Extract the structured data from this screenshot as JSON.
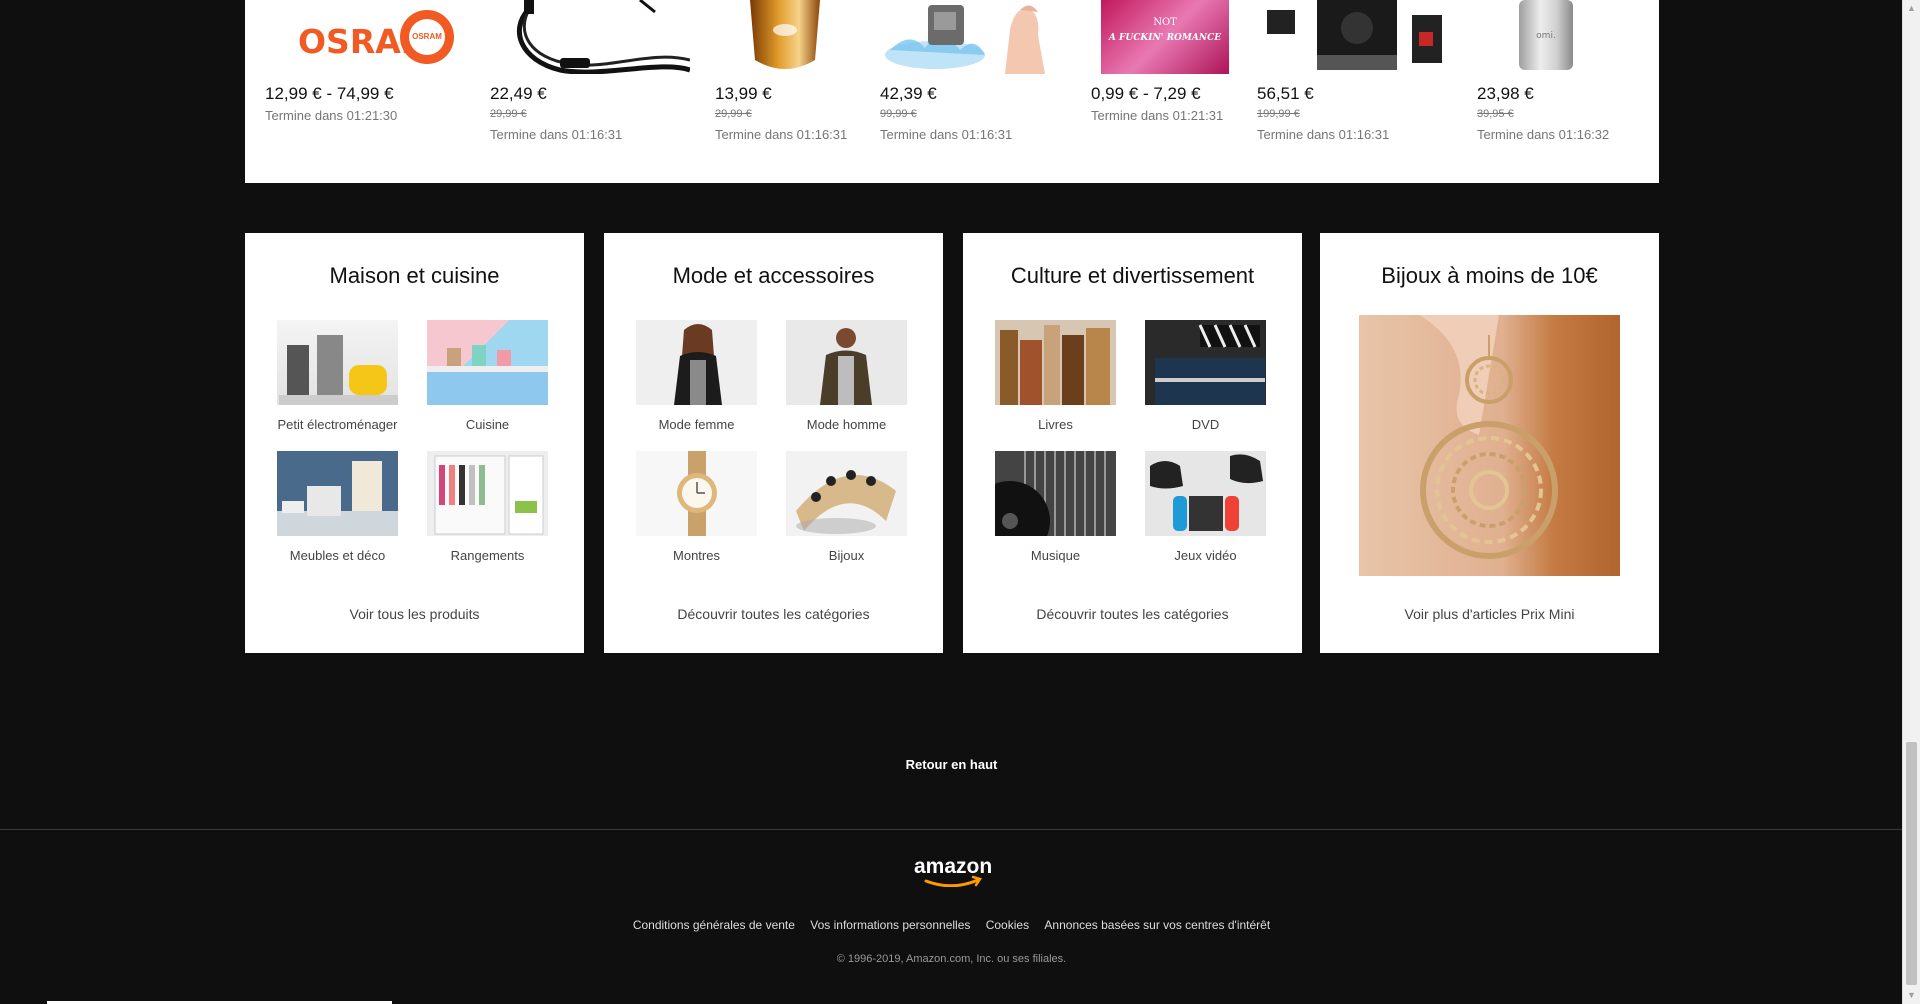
{
  "deals": [
    {
      "price": "12,99 € - 74,99 €",
      "old": "",
      "ends": "Termine dans 01:21:30",
      "brand": "OSRAM",
      "brand_badge": "OSRAM"
    },
    {
      "price": "22,49 €",
      "old": "29,99 €",
      "ends": "Termine dans 01:16:31"
    },
    {
      "price": "13,99 €",
      "old": "29,99 €",
      "ends": "Termine dans 01:16:31"
    },
    {
      "price": "42,39 €",
      "old": "99,99 €",
      "ends": "Termine dans 01:16:31"
    },
    {
      "price": "0,99 € - 7,29 €",
      "old": "",
      "ends": "Termine dans 01:21:31",
      "cover_text_1": "NOT",
      "cover_text_2": "A FUCKIN' ROMANCE"
    },
    {
      "price": "56,51 €",
      "old": "199,99 €",
      "ends": "Termine dans 01:16:31"
    },
    {
      "price": "23,98 €",
      "old": "39,95 €",
      "ends": "Termine dans 01:16:32",
      "bottle_text": "omi."
    }
  ],
  "cards": [
    {
      "title": "Maison et cuisine",
      "tiles": [
        "Petit électroménager",
        "Cuisine",
        "Meubles et déco",
        "Rangements"
      ],
      "link": "Voir tous les produits"
    },
    {
      "title": "Mode et accessoires",
      "tiles": [
        "Mode femme",
        "Mode homme",
        "Montres",
        "Bijoux"
      ],
      "link": "Découvrir toutes les catégories"
    },
    {
      "title": "Culture et divertissement",
      "tiles": [
        "Livres",
        "DVD",
        "Musique",
        "Jeux vidéo"
      ],
      "link": "Découvrir toutes les catégories"
    },
    {
      "title": "Bijoux à moins de 10€",
      "link": "Voir plus d'articles Prix Mini"
    }
  ],
  "back_to_top": "Retour en haut",
  "logo_text": "amazon",
  "footer_links": [
    "Conditions générales de vente",
    "Vos informations personnelles",
    "Cookies",
    "Annonces basées sur vos centres d'intérêt"
  ],
  "copyright": "© 1996-2019, Amazon.com, Inc. ou ses filiales.",
  "colors": {
    "background": "#0f0f0f",
    "card": "#ffffff",
    "osram": "#f15a22",
    "amazon_smile": "#ff9900"
  }
}
